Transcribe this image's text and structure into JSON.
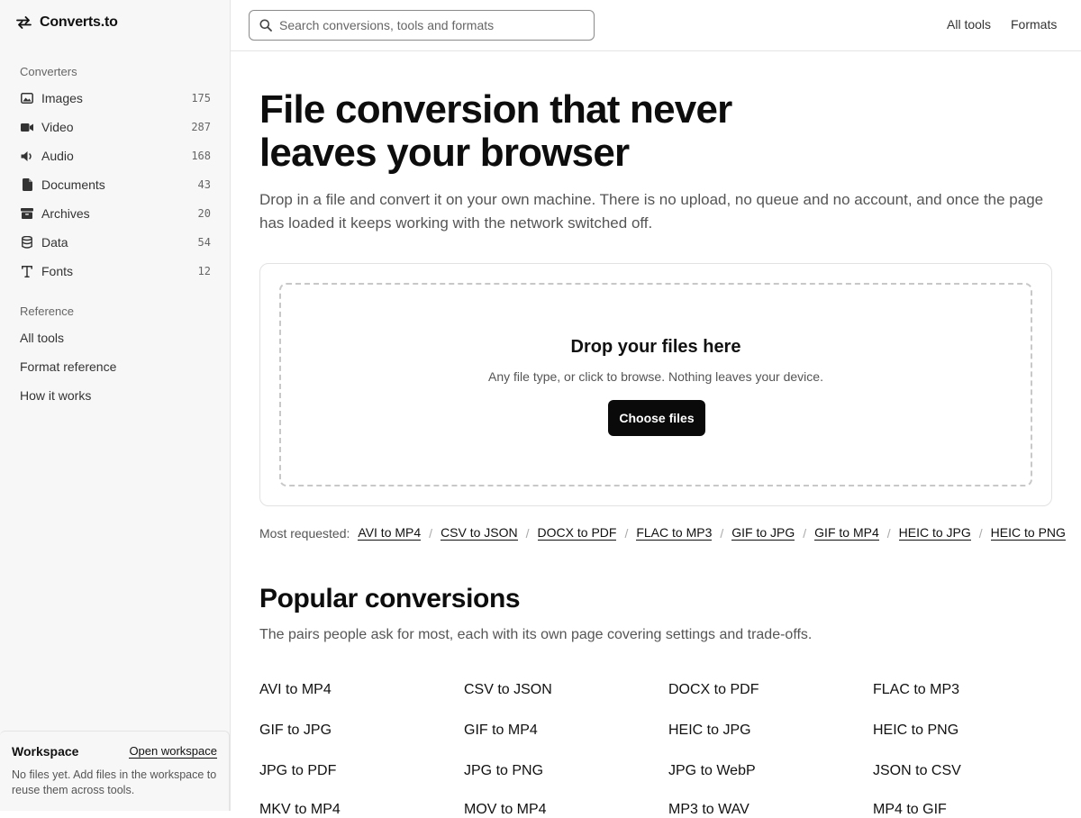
{
  "brand": {
    "name": "Converts.to"
  },
  "sidebar": {
    "converters_heading": "Converters",
    "items": [
      {
        "label": "Images",
        "count": "175",
        "icon": "image-icon"
      },
      {
        "label": "Video",
        "count": "287",
        "icon": "video-icon"
      },
      {
        "label": "Audio",
        "count": "168",
        "icon": "speaker-icon"
      },
      {
        "label": "Documents",
        "count": "43",
        "icon": "document-icon"
      },
      {
        "label": "Archives",
        "count": "20",
        "icon": "archive-icon"
      },
      {
        "label": "Data",
        "count": "54",
        "icon": "database-icon"
      },
      {
        "label": "Fonts",
        "count": "12",
        "icon": "font-icon"
      }
    ],
    "reference_heading": "Reference",
    "reference_items": [
      "All tools",
      "Format reference",
      "How it works"
    ]
  },
  "workspace": {
    "title": "Workspace",
    "open_label": "Open workspace",
    "description": "No files yet. Add files in the workspace to reuse them across tools."
  },
  "topbar": {
    "search_placeholder": "Search conversions, tools and formats",
    "links": [
      "All tools",
      "Formats"
    ]
  },
  "hero": {
    "title": "File conversion that never leaves your browser",
    "subtitle": "Drop in a file and convert it on your own machine. There is no upload, no queue and no account, and once the page has loaded it keeps working with the network switched off."
  },
  "dropzone": {
    "title": "Drop your files here",
    "hint": "Any file type, or click to browse. Nothing leaves your device.",
    "button": "Choose files"
  },
  "most_requested": {
    "label": "Most requested:",
    "links": [
      "AVI to MP4",
      "CSV to JSON",
      "DOCX to PDF",
      "FLAC to MP3",
      "GIF to JPG",
      "GIF to MP4",
      "HEIC to JPG",
      "HEIC to PNG"
    ]
  },
  "popular": {
    "title": "Popular conversions",
    "subtitle": "The pairs people ask for most, each with its own page covering settings and trade-offs.",
    "pairs": [
      "AVI to MP4",
      "CSV to JSON",
      "DOCX to PDF",
      "FLAC to MP3",
      "GIF to JPG",
      "GIF to MP4",
      "HEIC to JPG",
      "HEIC to PNG",
      "JPG to PDF",
      "JPG to PNG",
      "JPG to WebP",
      "JSON to CSV",
      "MKV to MP4",
      "MOV to MP4",
      "MP3 to WAV",
      "MP4 to GIF"
    ]
  }
}
